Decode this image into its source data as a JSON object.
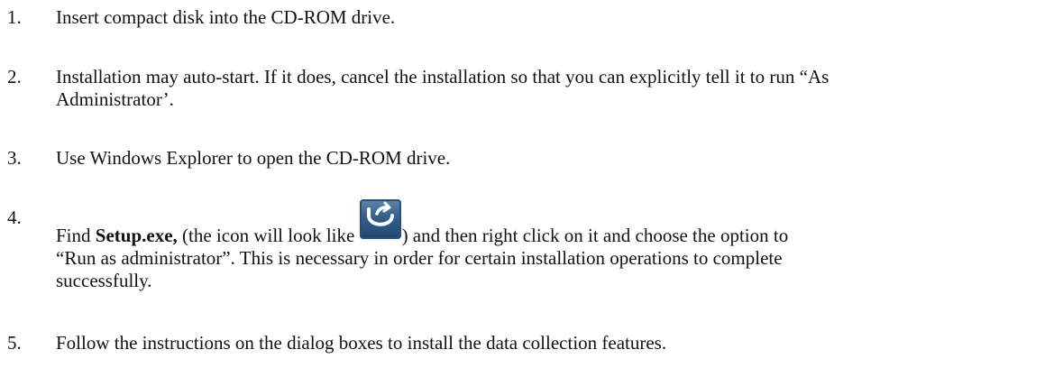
{
  "steps": [
    {
      "number": "1.",
      "text": "Insert compact disk into the CD-ROM drive."
    },
    {
      "number": "2.",
      "line1": "Installation may auto-start.  If it does, cancel the installation so that you can explicitly tell it to run “As",
      "line2": "Administrator’."
    },
    {
      "number": "3.",
      "text": "Use Windows Explorer to open the CD-ROM drive."
    },
    {
      "number": "4.",
      "prefix": "Find ",
      "bold": "Setup.exe,",
      "middle": " (the icon will look like ",
      "suffix": ") and then right click on it and choose the option to",
      "line2": "“Run as administrator”.   This is necessary in order for certain installation operations to complete",
      "line3": "successfully.",
      "icon": "setup-installer-icon"
    },
    {
      "number": "5.",
      "text": "Follow the instructions on the dialog boxes to install the data collection features."
    }
  ],
  "colors": {
    "text": "#111111",
    "icon_background": "#355f8a"
  }
}
